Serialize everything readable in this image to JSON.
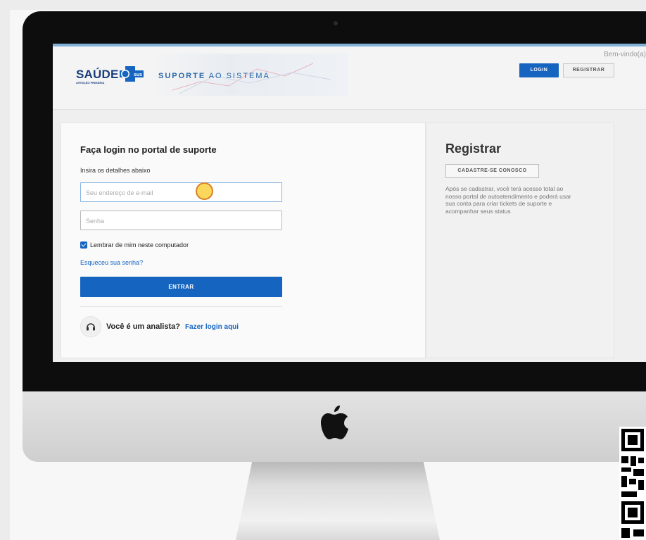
{
  "header": {
    "logo_text": "SAÚDE",
    "logo_subtext": "ATENÇÃO PRIMÁRIA",
    "logo_badge": "sus",
    "banner_bold": "SUPORTE",
    "banner_rest": " AO SISTEMA",
    "welcome": "Bem-vindo(a)",
    "login_button": "LOGIN",
    "register_button": "REGISTRAR"
  },
  "login": {
    "title": "Faça login no portal de suporte",
    "subtitle": "Insira os detalhes abaixo",
    "email_placeholder": "Seu endereço de e-mail",
    "password_placeholder": "Senha",
    "remember_label": "Lembrar de mim neste computador",
    "remember_checked": true,
    "forgot_link": "Esqueceu sua senha?",
    "submit_button": "ENTRAR",
    "analyst_question": "Você é um analista?",
    "analyst_link": "Fazer login aqui"
  },
  "register": {
    "title": "Registrar",
    "button": "CADASTRE-SE CONOSCO",
    "description": "Após se cadastrar, você terá acesso total ao nosso portal de autoatendimento e poderá usar sua conta para criar tickets de suporte e acompanhar seus status"
  },
  "colors": {
    "primary": "#1565c0",
    "brand_dark": "#1a3d7c",
    "cursor_highlight": "#fbd85b"
  }
}
